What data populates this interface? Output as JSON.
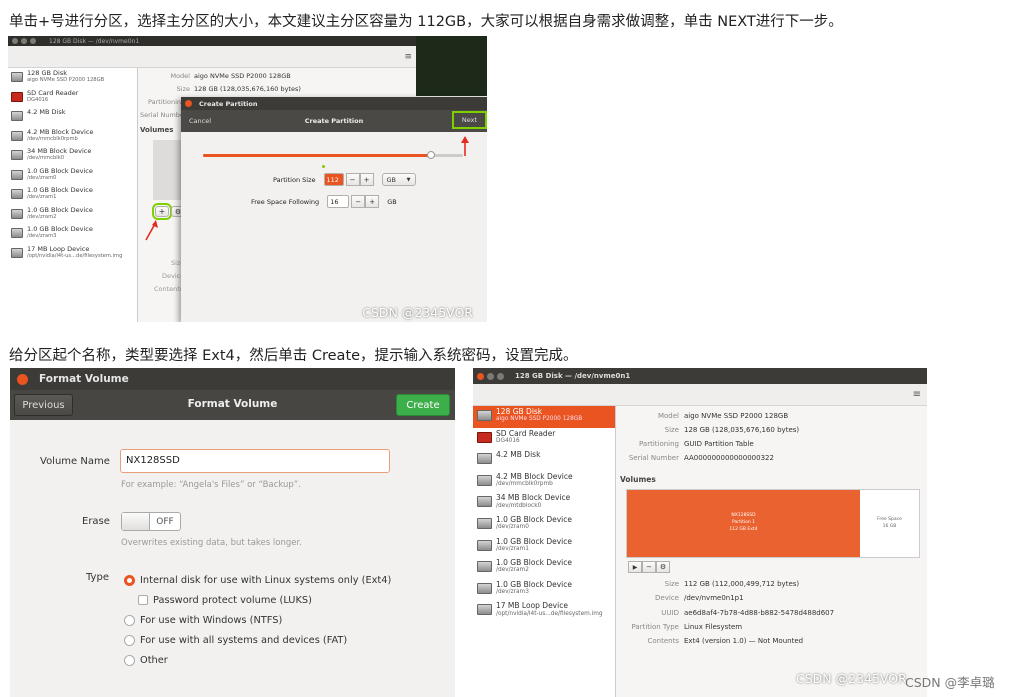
{
  "captions": {
    "step1": "单击+号进行分区，选择主分区的大小，本文建议主分区容量为 112GB，大家可以根据自身需求做调整，单击 NEXT进行下一步。",
    "step2": "给分区起个名称，类型要选择 Ext4，然后单击 Create，提示输入系统密码，设置完成。"
  },
  "shot1": {
    "title": "128 GB Disk — /dev/nvme0n1",
    "devices": [
      {
        "name": "128 GB Disk",
        "sub": "aigo NVMe SSD P2000 128GB"
      },
      {
        "name": "SD Card Reader",
        "sub": "DG4016"
      },
      {
        "name": "4.2 MB Disk",
        "sub": ""
      },
      {
        "name": "4.2 MB Block Device",
        "sub": "/dev/mmcblk0rpmb"
      },
      {
        "name": "34 MB Block Device",
        "sub": "/dev/mmcblk0"
      },
      {
        "name": "1.0 GB Block Device",
        "sub": "/dev/zram0"
      },
      {
        "name": "1.0 GB Block Device",
        "sub": "/dev/zram1"
      },
      {
        "name": "1.0 GB Block Device",
        "sub": "/dev/zram2"
      },
      {
        "name": "1.0 GB Block Device",
        "sub": "/dev/zram3"
      },
      {
        "name": "17 MB Loop Device",
        "sub": "/opt/nvidia/l4t-us...de/filesystem.img"
      }
    ],
    "info": {
      "model_label": "Model",
      "model": "aigo NVMe SSD P2000 128GB",
      "size_label": "Size",
      "size": "128 GB (128,035,676,160 bytes)",
      "partitioning_label": "Partitioning",
      "serial_label": "Serial Number"
    },
    "volumes_label": "Volumes",
    "side_labels": {
      "size": "Size",
      "device": "Device",
      "contents": "Contents"
    },
    "add_glyph": "+",
    "dialog": {
      "title": "Create Partition",
      "cancel": "Cancel",
      "heading": "Create Partition",
      "next": "Next",
      "slider_fraction": 0.875,
      "partition_size_label": "Partition Size",
      "partition_size_value": "112",
      "minus": "−",
      "plus": "+",
      "unit": "GB",
      "free_label": "Free Space Following",
      "free_value": "16",
      "free_unit": "GB"
    },
    "watermark": "CSDN @2345VOR"
  },
  "shot2": {
    "title": "Format Volume",
    "previous": "Previous",
    "heading": "Format Volume",
    "create": "Create",
    "volume_name_label": "Volume Name",
    "volume_name_value": "NX128SSD",
    "volume_name_hint": "For example: “Angela's Files” or “Backup”.",
    "erase_label": "Erase",
    "erase_toggle": "OFF",
    "erase_hint": "Overwrites existing data, but takes longer.",
    "type_label": "Type",
    "options": [
      {
        "label": "Internal disk for use with Linux systems only (Ext4)",
        "kind": "radio",
        "checked": true
      },
      {
        "label": "Password protect volume (LUKS)",
        "kind": "check",
        "checked": false
      },
      {
        "label": "For use with Windows (NTFS)",
        "kind": "radio",
        "checked": false
      },
      {
        "label": "For use with all systems and devices (FAT)",
        "kind": "radio",
        "checked": false
      },
      {
        "label": "Other",
        "kind": "radio",
        "checked": false
      }
    ]
  },
  "shot3": {
    "title": "128 GB Disk — /dev/nvme0n1",
    "devices": [
      {
        "name": "128 GB Disk",
        "sub": "aigo NVMe SSD P2000 128GB"
      },
      {
        "name": "SD Card Reader",
        "sub": "DG4016"
      },
      {
        "name": "4.2 MB Disk",
        "sub": ""
      },
      {
        "name": "4.2 MB Block Device",
        "sub": "/dev/mmcblk0rpmb"
      },
      {
        "name": "34 MB Block Device",
        "sub": "/dev/mtdblock0"
      },
      {
        "name": "1.0 GB Block Device",
        "sub": "/dev/zram0"
      },
      {
        "name": "1.0 GB Block Device",
        "sub": "/dev/zram1"
      },
      {
        "name": "1.0 GB Block Device",
        "sub": "/dev/zram2"
      },
      {
        "name": "1.0 GB Block Device",
        "sub": "/dev/zram3"
      },
      {
        "name": "17 MB Loop Device",
        "sub": "/opt/nvidia/l4t-us...de/filesystem.img"
      }
    ],
    "top_info": [
      {
        "k": "Model",
        "v": "aigo NVMe SSD P2000 128GB"
      },
      {
        "k": "Size",
        "v": "128 GB (128,035,676,160 bytes)"
      },
      {
        "k": "Partitioning",
        "v": "GUID Partition Table"
      },
      {
        "k": "Serial Number",
        "v": "AA000000000000000322"
      }
    ],
    "volumes_label": "Volumes",
    "partition": {
      "name": "NX128SSD",
      "line2": "Partition 1",
      "line3": "112 GB Ext4"
    },
    "free": {
      "line1": "Free Space",
      "line2": "16 GB"
    },
    "controls": [
      "▶",
      "−",
      "⚙"
    ],
    "bottom_info": [
      {
        "k": "Size",
        "v": "112 GB (112,000,499,712 bytes)"
      },
      {
        "k": "Device",
        "v": "/dev/nvme0n1p1"
      },
      {
        "k": "UUID",
        "v": "ae6d8af4-7b78-4d88-b882-5478d488d607"
      },
      {
        "k": "Partition Type",
        "v": "Linux Filesystem"
      },
      {
        "k": "Contents",
        "v": "Ext4 (version 1.0) — Not Mounted"
      }
    ],
    "watermark": "CSDN @2345VOR",
    "watermark2": "CSDN @李卓璐"
  },
  "colors": {
    "accent": "#e95420",
    "title_bar": "#3c3b37",
    "create_green": "#3cae4a",
    "highlight": "#7fd000"
  }
}
